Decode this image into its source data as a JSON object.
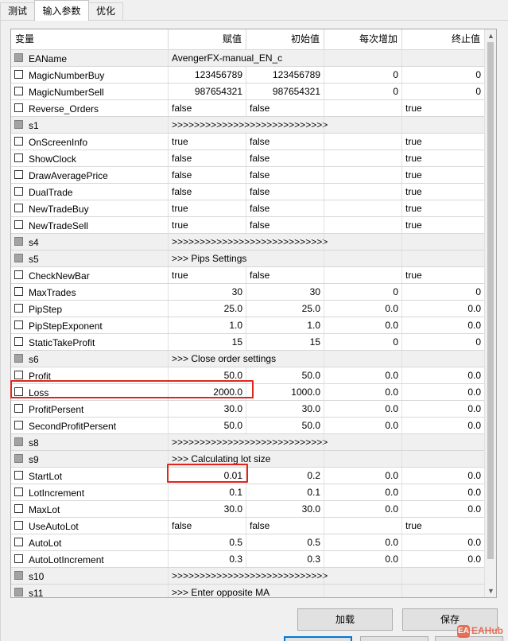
{
  "tabs": [
    {
      "label": "测试"
    },
    {
      "label": "输入参数"
    },
    {
      "label": "优化"
    }
  ],
  "columns": {
    "name": "变量",
    "value": "赋值",
    "initial": "初始值",
    "step": "每次增加",
    "stop": "终止值"
  },
  "rows": [
    {
      "name": "EAName",
      "value": "AvengerFX-manual_EN_c",
      "initial": "",
      "step": "",
      "stop": "",
      "group": true
    },
    {
      "name": "MagicNumberBuy",
      "value": "123456789",
      "initial": "123456789",
      "step": "0",
      "stop": "0",
      "group": false
    },
    {
      "name": "MagicNumberSell",
      "value": "987654321",
      "initial": "987654321",
      "step": "0",
      "stop": "0",
      "group": false
    },
    {
      "name": "Reverse_Orders",
      "value": "false",
      "initial": "false",
      "step": "",
      "stop": "true",
      "group": false
    },
    {
      "name": "s1",
      "value": ">>>>>>>>>>>>>>>>>>>>>>>>>>>>",
      "initial": "",
      "step": "",
      "stop": "",
      "group": true
    },
    {
      "name": "OnScreenInfo",
      "value": "true",
      "initial": "false",
      "step": "",
      "stop": "true",
      "group": false
    },
    {
      "name": "ShowClock",
      "value": "false",
      "initial": "false",
      "step": "",
      "stop": "true",
      "group": false
    },
    {
      "name": "DrawAveragePrice",
      "value": "false",
      "initial": "false",
      "step": "",
      "stop": "true",
      "group": false
    },
    {
      "name": "DualTrade",
      "value": "false",
      "initial": "false",
      "step": "",
      "stop": "true",
      "group": false
    },
    {
      "name": "NewTradeBuy",
      "value": "true",
      "initial": "false",
      "step": "",
      "stop": "true",
      "group": false
    },
    {
      "name": "NewTradeSell",
      "value": "true",
      "initial": "false",
      "step": "",
      "stop": "true",
      "group": false
    },
    {
      "name": "s4",
      "value": ">>>>>>>>>>>>>>>>>>>>>>>>>>>>",
      "initial": "",
      "step": "",
      "stop": "",
      "group": true
    },
    {
      "name": "s5",
      "value": ">>> Pips Settings",
      "initial": "",
      "step": "",
      "stop": "",
      "group": true
    },
    {
      "name": "CheckNewBar",
      "value": "true",
      "initial": "false",
      "step": "",
      "stop": "true",
      "group": false
    },
    {
      "name": "MaxTrades",
      "value": "30",
      "initial": "30",
      "step": "0",
      "stop": "0",
      "group": false
    },
    {
      "name": "PipStep",
      "value": "25.0",
      "initial": "25.0",
      "step": "0.0",
      "stop": "0.0",
      "group": false
    },
    {
      "name": "PipStepExponent",
      "value": "1.0",
      "initial": "1.0",
      "step": "0.0",
      "stop": "0.0",
      "group": false
    },
    {
      "name": "StaticTakeProfit",
      "value": "15",
      "initial": "15",
      "step": "0",
      "stop": "0",
      "group": false
    },
    {
      "name": "s6",
      "value": ">>> Close order settings",
      "initial": "",
      "step": "",
      "stop": "",
      "group": true
    },
    {
      "name": "Profit",
      "value": "50.0",
      "initial": "50.0",
      "step": "0.0",
      "stop": "0.0",
      "group": false
    },
    {
      "name": "Loss",
      "value": "2000.0",
      "initial": "1000.0",
      "step": "0.0",
      "stop": "0.0",
      "group": false
    },
    {
      "name": "ProfitPersent",
      "value": "30.0",
      "initial": "30.0",
      "step": "0.0",
      "stop": "0.0",
      "group": false
    },
    {
      "name": "SecondProfitPersent",
      "value": "50.0",
      "initial": "50.0",
      "step": "0.0",
      "stop": "0.0",
      "group": false
    },
    {
      "name": "s8",
      "value": ">>>>>>>>>>>>>>>>>>>>>>>>>>>>",
      "initial": "",
      "step": "",
      "stop": "",
      "group": true
    },
    {
      "name": "s9",
      "value": ">>> Calculating lot size",
      "initial": "",
      "step": "",
      "stop": "",
      "group": true
    },
    {
      "name": "StartLot",
      "value": "0.01",
      "initial": "0.2",
      "step": "0.0",
      "stop": "0.0",
      "group": false
    },
    {
      "name": "LotIncrement",
      "value": "0.1",
      "initial": "0.1",
      "step": "0.0",
      "stop": "0.0",
      "group": false
    },
    {
      "name": "MaxLot",
      "value": "30.0",
      "initial": "30.0",
      "step": "0.0",
      "stop": "0.0",
      "group": false
    },
    {
      "name": "UseAutoLot",
      "value": "false",
      "initial": "false",
      "step": "",
      "stop": "true",
      "group": false
    },
    {
      "name": "AutoLot",
      "value": "0.5",
      "initial": "0.5",
      "step": "0.0",
      "stop": "0.0",
      "group": false
    },
    {
      "name": "AutoLotIncrement",
      "value": "0.3",
      "initial": "0.3",
      "step": "0.0",
      "stop": "0.0",
      "group": false
    },
    {
      "name": "s10",
      "value": ">>>>>>>>>>>>>>>>>>>>>>>>>>>>",
      "initial": "",
      "step": "",
      "stop": "",
      "group": true
    },
    {
      "name": "s11",
      "value": ">>> Enter opposite MA",
      "initial": "",
      "step": "",
      "stop": "",
      "group": true
    }
  ],
  "buttons": {
    "load": "加载",
    "save": "保存"
  },
  "watermark": {
    "badge": "EA",
    "text": "EAHub"
  },
  "colors": {
    "highlight": "#e0261c",
    "watermark": "#e65a3c"
  }
}
